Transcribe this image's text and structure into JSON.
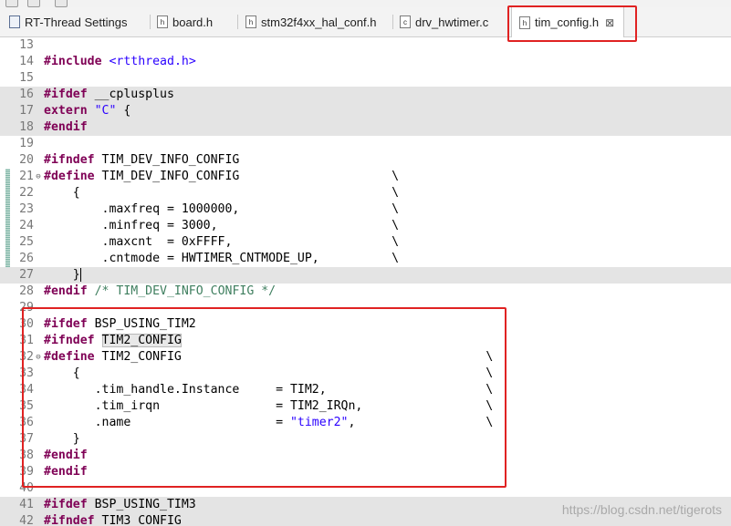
{
  "tabs": [
    {
      "label": "RT-Thread Settings",
      "icon": "settings-file-icon",
      "active": false
    },
    {
      "label": "board.h",
      "icon": "header-file-icon",
      "active": false
    },
    {
      "label": "stm32f4xx_hal_conf.h",
      "icon": "header-file-icon",
      "active": false
    },
    {
      "label": "drv_hwtimer.c",
      "icon": "c-file-icon",
      "active": false
    },
    {
      "label": "tim_config.h",
      "icon": "header-file-icon",
      "active": true
    }
  ],
  "tab_close_glyph": "⊠",
  "icon_letters": {
    "h": "h",
    "c": "c"
  },
  "lines": [
    {
      "n": "13",
      "t": ""
    },
    {
      "n": "14",
      "t": "#include <rtthread.h>"
    },
    {
      "n": "15",
      "t": ""
    },
    {
      "n": "16",
      "t": "#ifdef __cplusplus"
    },
    {
      "n": "17",
      "t": "extern \"C\" {"
    },
    {
      "n": "18",
      "t": "#endif"
    },
    {
      "n": "19",
      "t": ""
    },
    {
      "n": "20",
      "t": "#ifndef TIM_DEV_INFO_CONFIG"
    },
    {
      "n": "21",
      "t": "#define TIM_DEV_INFO_CONFIG                     \\"
    },
    {
      "n": "22",
      "t": "    {                                           \\"
    },
    {
      "n": "23",
      "t": "        .maxfreq = 1000000,                     \\"
    },
    {
      "n": "24",
      "t": "        .minfreq = 3000,                        \\"
    },
    {
      "n": "25",
      "t": "        .maxcnt  = 0xFFFF,                      \\"
    },
    {
      "n": "26",
      "t": "        .cntmode = HWTIMER_CNTMODE_UP,          \\"
    },
    {
      "n": "27",
      "t": "    }"
    },
    {
      "n": "28",
      "t": "#endif /* TIM_DEV_INFO_CONFIG */"
    },
    {
      "n": "29",
      "t": ""
    },
    {
      "n": "30",
      "t": "#ifdef BSP_USING_TIM2"
    },
    {
      "n": "31",
      "t": "#ifndef TIM2_CONFIG"
    },
    {
      "n": "32",
      "t": "#define TIM2_CONFIG                                          \\"
    },
    {
      "n": "33",
      "t": "    {                                                        \\"
    },
    {
      "n": "34",
      "t": "       .tim_handle.Instance     = TIM2,                      \\"
    },
    {
      "n": "35",
      "t": "       .tim_irqn                = TIM2_IRQn,                 \\"
    },
    {
      "n": "36",
      "t": "       .name                    = \"timer2\",                  \\"
    },
    {
      "n": "37",
      "t": "    }"
    },
    {
      "n": "38",
      "t": "#endif"
    },
    {
      "n": "39",
      "t": "#endif"
    },
    {
      "n": "40",
      "t": ""
    },
    {
      "n": "41",
      "t": "#ifdef BSP_USING_TIM3"
    },
    {
      "n": "42",
      "t": "#ifndef TIM3_CONFIG"
    }
  ],
  "highlighted_word": "TIM2_CONFIG",
  "watermark": "https://blog.csdn.net/tigerots",
  "colors": {
    "keyword": "#7f0055",
    "string": "#2a00ff",
    "comment": "#3f7f5f",
    "annotation": "#e02222"
  }
}
